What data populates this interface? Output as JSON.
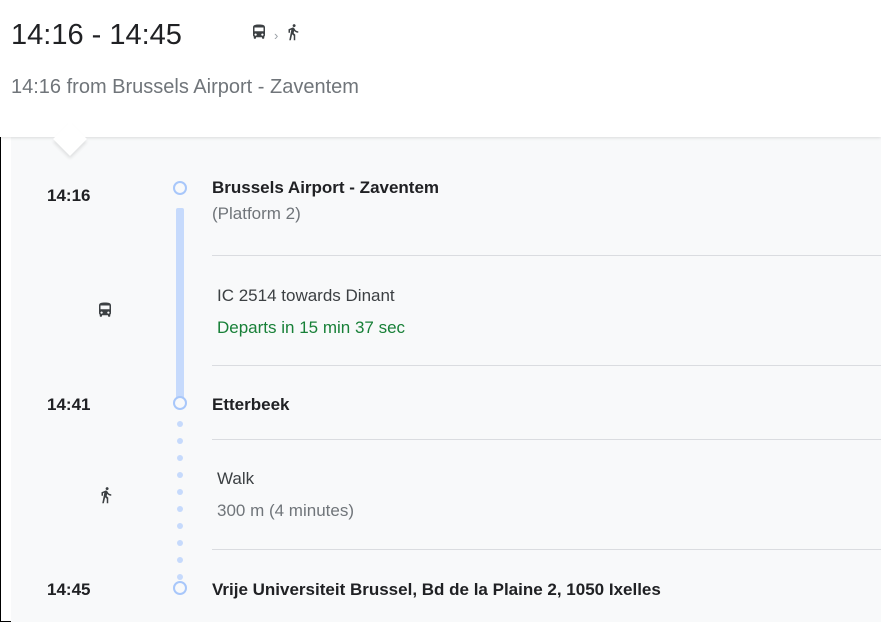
{
  "header": {
    "time_range": "14:16 - 14:45",
    "modes": [
      "bus-icon",
      "chevron-right-icon",
      "walk-icon"
    ],
    "subtitle": "14:16 from Brussels Airport - Zaventem"
  },
  "timeline": {
    "stops": [
      {
        "time": "14:16",
        "name": "Brussels Airport - Zaventem",
        "detail": "(Platform 2)"
      },
      {
        "time": "14:41",
        "name": "Etterbeek",
        "detail": ""
      },
      {
        "time": "14:45",
        "name": "Vrije Universiteit Brussel, Bd de la Plaine 2, 1050 Ixelles",
        "detail": ""
      }
    ],
    "segments": [
      {
        "mode": "train-icon",
        "title": "IC 2514 towards Dinant",
        "status": "Departs in 15 min 37 sec"
      },
      {
        "mode": "walk-icon",
        "title": "Walk",
        "status": "300 m (4 minutes)"
      }
    ]
  },
  "colors": {
    "line": "#c6dafc",
    "stop_ring": "#a8c7fa",
    "departs_green": "#188038",
    "muted_text": "#70757a"
  }
}
